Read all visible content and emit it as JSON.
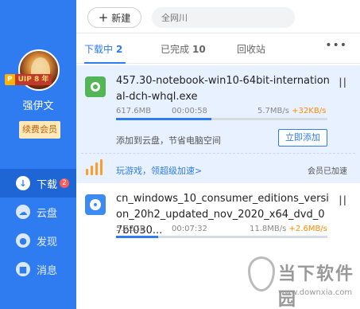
{
  "sidebar": {
    "vip_badge": {
      "p": "P",
      "label": "UIP 8 年"
    },
    "username": "强伊文",
    "renew_label": "续费会员",
    "items": [
      {
        "label": "下载",
        "icon": "download-icon",
        "glyph": "↓",
        "badge": "2"
      },
      {
        "label": "云盘",
        "icon": "cloud-icon",
        "glyph": "☁"
      },
      {
        "label": "发现",
        "icon": "discover-icon",
        "glyph": "●"
      },
      {
        "label": "消息",
        "icon": "message-icon",
        "glyph": "■"
      }
    ]
  },
  "toolbar": {
    "new_label": "新建",
    "new_icon": "+",
    "search_placeholder": "全网川"
  },
  "tabs": [
    {
      "label": "下载中",
      "count": "2"
    },
    {
      "label": "已完成",
      "count": "10"
    },
    {
      "label": "回收站",
      "count": ""
    }
  ],
  "more_icon": "•••",
  "tasks": [
    {
      "name": "457.30-notebook-win10-64bit-international-dch-whql.exe",
      "size": "617.6MB",
      "time": "00:00:58",
      "speed": "5.7MB/s",
      "boost": "+32KB/s",
      "progress": 0.45,
      "pause_icon": "||",
      "cloud_tip": "添加到云盘，节省电脑空间",
      "add_label": "立即添加",
      "promo_link": "玩游戏，领超级加速>",
      "member_status": "会员已加速"
    },
    {
      "name": "cn_windows_10_consumer_editions_version_20h2_updated_nov_2020_x64_dvd_07bf030...",
      "size": "5.72GB",
      "time": "00:07:32",
      "speed": "11.8MB/s",
      "boost": "+2.6MB/s",
      "progress": 0.2,
      "pause_icon": "||"
    }
  ],
  "watermark": {
    "title": "当下软件园",
    "url": "www.downxia.com"
  },
  "colors": {
    "accent": "#2f7cf0",
    "boost": "#ff8a00",
    "sidebar": "#2f7cf0"
  }
}
